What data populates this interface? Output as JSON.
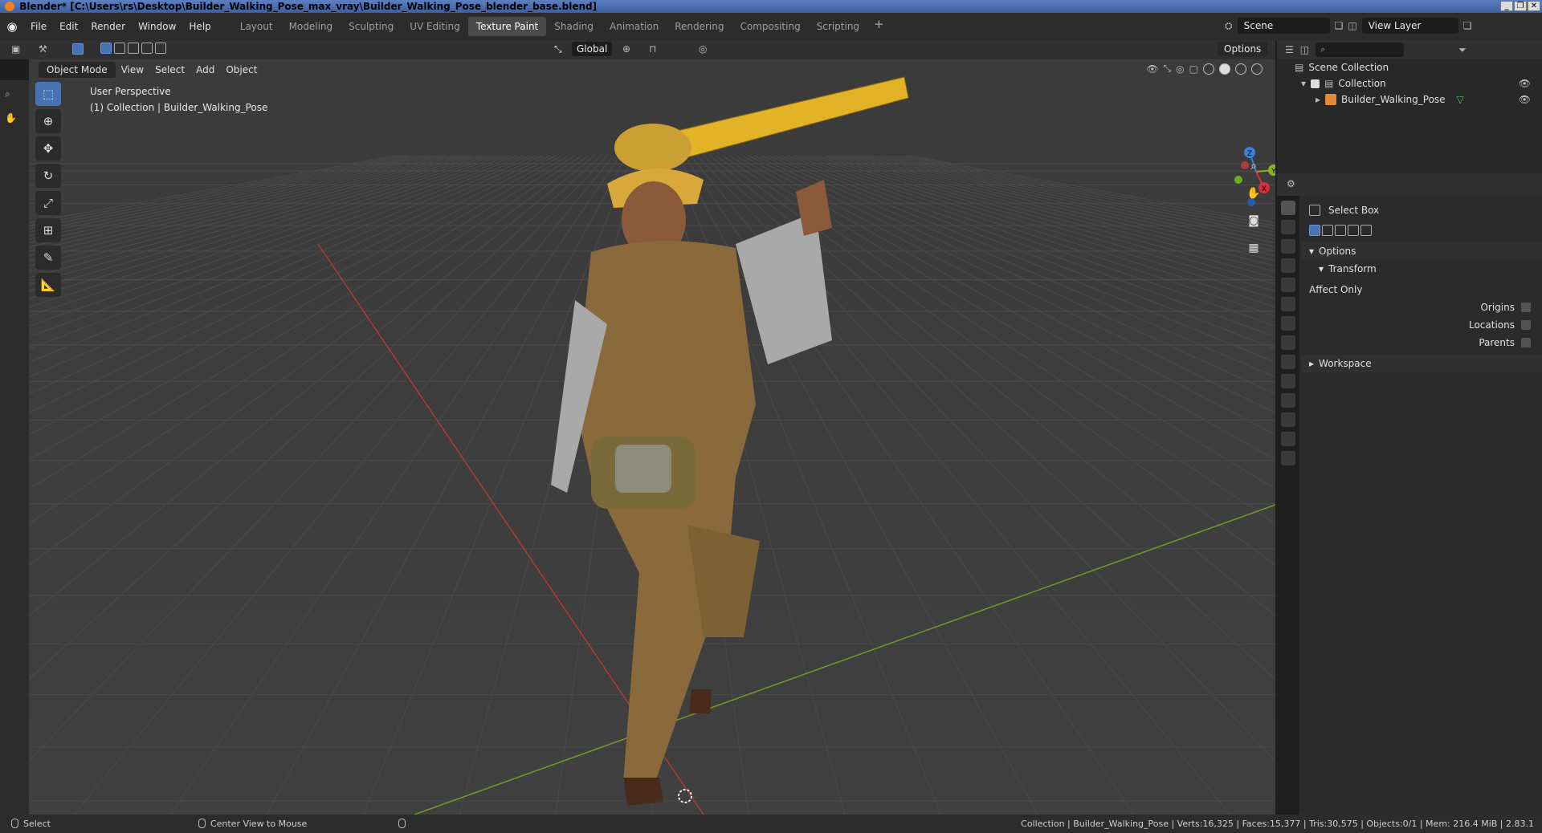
{
  "window": {
    "title": "Blender* [C:\\Users\\rs\\Desktop\\Builder_Walking_Pose_max_vray\\Builder_Walking_Pose_blender_base.blend]",
    "controls": [
      "_",
      "❐",
      "✕"
    ]
  },
  "topbar": {
    "menus": [
      "File",
      "Edit",
      "Render",
      "Window",
      "Help"
    ],
    "workspace_tabs": [
      "Layout",
      "Modeling",
      "Sculpting",
      "UV Editing",
      "Texture Paint",
      "Shading",
      "Animation",
      "Rendering",
      "Compositing",
      "Scripting"
    ],
    "active_tab": "Texture Paint",
    "add_tab": "+",
    "scene": "Scene",
    "view_layer": "View Layer"
  },
  "viewport_header": {
    "transform_orientation": "Global",
    "options_label": "Options",
    "mode": "Object Mode",
    "menus": [
      "View",
      "Select",
      "Add",
      "Object"
    ]
  },
  "viewport": {
    "perspective_label": "User Perspective",
    "collection_label": "(1) Collection | Builder_Walking_Pose",
    "gizmo_axes": [
      "Z",
      "Y",
      "X"
    ],
    "colors": {
      "background": "#3d3d3d",
      "grid": "#4a4a4a",
      "x_axis": "#b03a3a",
      "y_axis": "#6f9a2a"
    }
  },
  "outliner": {
    "scene_collection": "Scene Collection",
    "collection": "Collection",
    "object": "Builder_Walking_Pose"
  },
  "properties": {
    "tool_name": "Select Box",
    "options_label": "Options",
    "transform_label": "Transform",
    "affect_only_label": "Affect Only",
    "origins_label": "Origins",
    "locations_label": "Locations",
    "parents_label": "Parents",
    "workspace_label": "Workspace"
  },
  "statusbar": {
    "left_action": "Select",
    "middle_action": "Center View to Mouse",
    "stats": "Collection | Builder_Walking_Pose | Verts:16,325 | Faces:15,377 | Tris:30,575 | Objects:0/1 | Mem: 216.4 MiB | 2.83.1"
  }
}
